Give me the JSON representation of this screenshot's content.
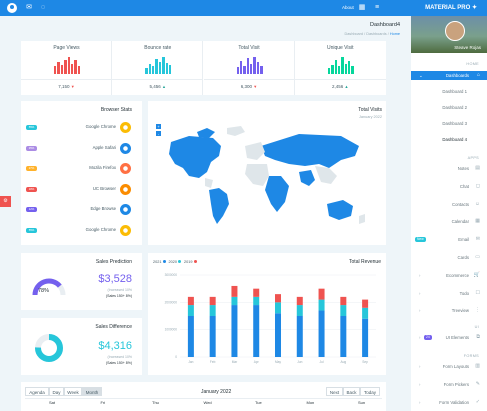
{
  "topbar": {
    "about_label": "About",
    "brand": "MATERIAL PRO"
  },
  "sidebar": {
    "user_name": "Steave Rojas",
    "home_heading": "HOME",
    "apps_heading": "APPS",
    "ui_heading": "UI",
    "forms_heading": "FORMS",
    "dashboards_label": "Dashboards",
    "dash_items": [
      "Dashboard 1",
      "Dashboard 2",
      "Dashboard 3",
      "Dashboard 4"
    ],
    "apps": [
      "Notes",
      "Chat",
      "Contacts",
      "Calendar",
      "Email",
      "Cards",
      "Ecommerce",
      "Todo",
      "Treeview"
    ],
    "email_badge": "New",
    "ui_item": "UI Elements",
    "ui_badge": "24",
    "forms": [
      "Form Layouts",
      "Form Pickers",
      "Form Validation"
    ]
  },
  "header": {
    "title": "Dashboard4",
    "crumb_1": "Dashboard",
    "crumb_2": "Dashboards",
    "crumb_3": "Home"
  },
  "stats": [
    {
      "title": "Page Views",
      "value": "7,150",
      "trend": "down",
      "color": "#ef5350",
      "bars": [
        0.45,
        0.7,
        0.55,
        0.85,
        1.0,
        0.6,
        0.8,
        0.5
      ]
    },
    {
      "title": "Bounce rate",
      "value": "5,456",
      "trend": "up",
      "color": "#26c6da",
      "bars": [
        0.35,
        0.6,
        0.5,
        0.9,
        0.7,
        1.0,
        0.65,
        0.55
      ]
    },
    {
      "title": "Total Visit",
      "value": "6,300",
      "trend": "down",
      "color": "#7460ee",
      "bars": [
        0.4,
        0.75,
        0.5,
        0.95,
        0.6,
        1.0,
        0.7,
        0.5
      ]
    },
    {
      "title": "Unique Visit",
      "value": "2,456",
      "trend": "up",
      "color": "#06d79c",
      "bars": [
        0.35,
        0.55,
        0.8,
        0.45,
        1.0,
        0.6,
        0.75,
        0.5
      ]
    }
  ],
  "browser_stats": {
    "title": "Browser Stats",
    "items": [
      {
        "badge": "55%",
        "badge_color": "#26c6da",
        "name": "Google Chrome",
        "logo_color": "#fbbc05"
      },
      {
        "badge": "35%",
        "badge_color": "#ab8ce4",
        "name": "Apple Safari",
        "logo_color": "#1e88e5"
      },
      {
        "badge": "27%",
        "badge_color": "#ffb22b",
        "name": "Mozila Firefox",
        "logo_color": "#ff7043"
      },
      {
        "badge": "18%",
        "badge_color": "#ef5350",
        "name": "UC Browser",
        "logo_color": "#fb8c00"
      },
      {
        "badge": "12%",
        "badge_color": "#7460ee",
        "name": "Edge Browse",
        "logo_color": "#1e88e5"
      },
      {
        "badge": "55%",
        "badge_color": "#26c6da",
        "name": "Google Chrome",
        "logo_color": "#fbbc05"
      }
    ]
  },
  "total_visits": {
    "title": "Total Visits",
    "subtitle": "January 2022",
    "zoom_in": "+",
    "zoom_out": "-"
  },
  "sales_prediction": {
    "title": "Sales Prediction",
    "percent_label": "78%",
    "percent": 0.78,
    "amount": "$3,528",
    "note_1": "(Increased 10%",
    "note_2": "(Sales 150+ 8%)"
  },
  "sales_difference": {
    "title": "Sales Difference",
    "amount": "$4,316",
    "note_1": "(Increased 10%",
    "note_2": "(Sales 150+ 8%)"
  },
  "chart_data": {
    "type": "bar",
    "title": "Total Revenue",
    "series": [
      {
        "name": "2021",
        "color": "#1e88e5",
        "values": [
          150000,
          150000,
          190000,
          190000,
          160000,
          150000,
          170000,
          150000,
          140000
        ]
      },
      {
        "name": "2020",
        "color": "#26c6da",
        "values": [
          40000,
          40000,
          30000,
          30000,
          40000,
          40000,
          40000,
          40000,
          40000
        ]
      },
      {
        "name": "2019",
        "color": "#ef5350",
        "values": [
          30000,
          30000,
          40000,
          30000,
          30000,
          30000,
          40000,
          30000,
          30000
        ]
      }
    ],
    "categories": [
      "Jan",
      "Feb",
      "Mar",
      "Apr",
      "May",
      "Jun",
      "Jul",
      "Aug",
      "Sep"
    ],
    "yticks": [
      "0",
      "1000000",
      "2000000",
      "3000000"
    ],
    "ylim": [
      0,
      300000
    ],
    "legend": "top-left"
  },
  "calendar": {
    "buttons": [
      "Agenda",
      "Day",
      "Week",
      "Month"
    ],
    "month": "January 2022",
    "nav": [
      "Next",
      "Back",
      "Today"
    ],
    "days": [
      "Sat",
      "Fri",
      "Thu",
      "Wed",
      "Tue",
      "Mon",
      "Sun"
    ]
  }
}
